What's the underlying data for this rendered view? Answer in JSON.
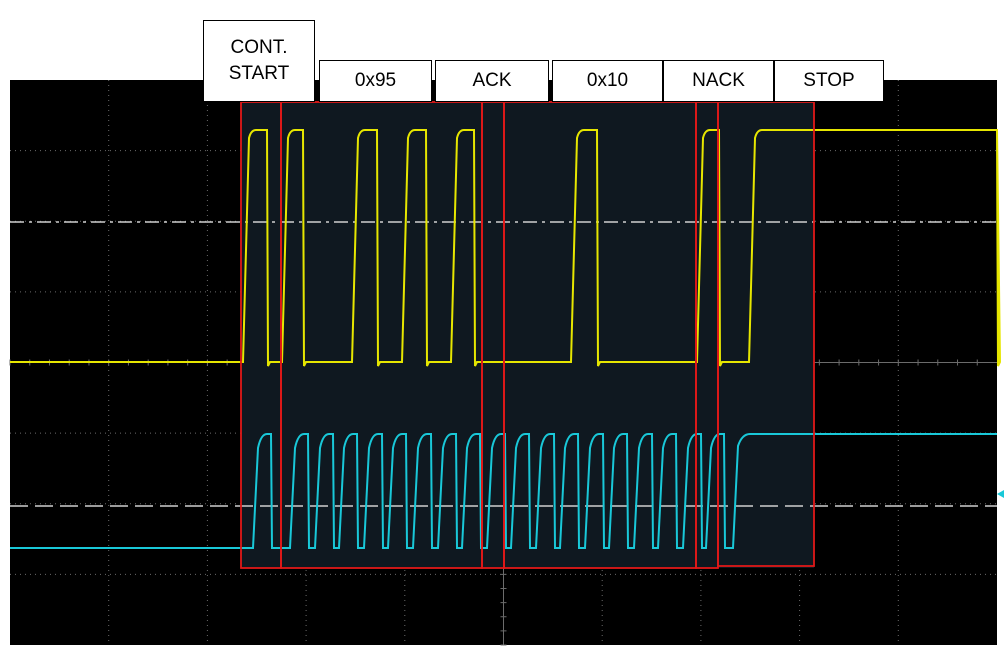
{
  "chart_data": {
    "type": "line",
    "title": "",
    "xlabel": "",
    "ylabel": "",
    "grid": true,
    "colors": {
      "screen": "#000000",
      "grid": "#6b6b6b",
      "ch1": "#e6e600",
      "ch2": "#19c8d8",
      "frames": "#e01818",
      "highlight": "#0f1820",
      "threshold": "#d0d0d0"
    },
    "segments": [
      {
        "label": "CONT.\nSTART"
      },
      {
        "label": "0x95"
      },
      {
        "label": "ACK"
      },
      {
        "label": "0x10"
      },
      {
        "label": "NACK"
      },
      {
        "label": "STOP"
      }
    ],
    "series": [
      {
        "id": "ch1",
        "bytes": [
          "0x95",
          "0x10"
        ],
        "ack_bits": [
          0,
          1
        ],
        "idle_level": "high"
      },
      {
        "id": "ch2",
        "clock_pulses": 19,
        "idle_level": "high"
      }
    ]
  }
}
